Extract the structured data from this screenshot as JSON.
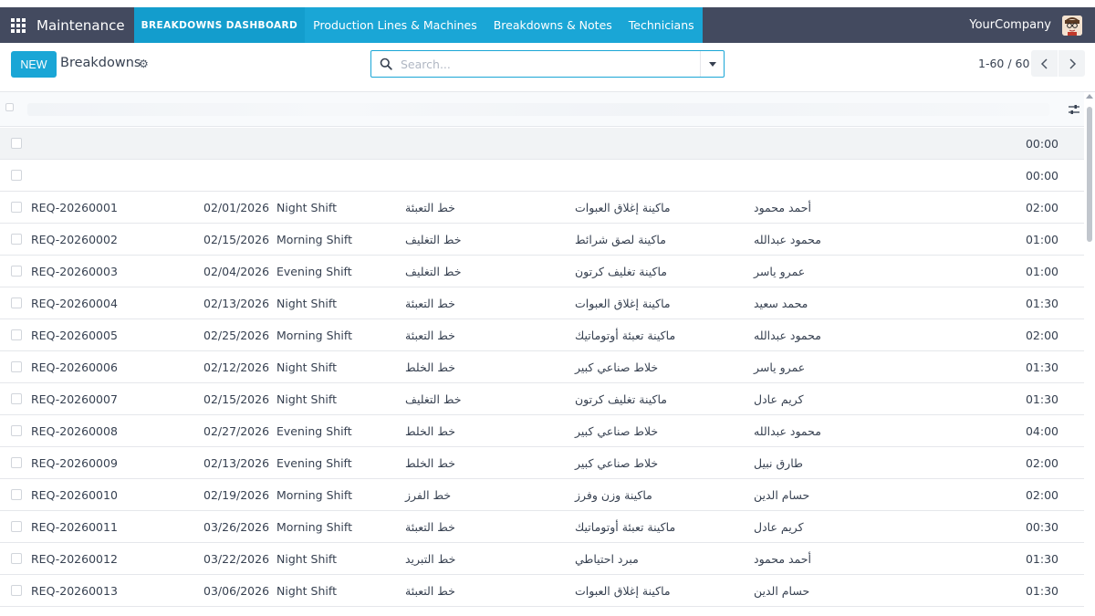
{
  "navbar": {
    "app_name": "Maintenance",
    "menu": [
      {
        "label": "BREAKDOWNS DASHBOARD",
        "active": true
      },
      {
        "label": "Production Lines & Machines",
        "active": false
      },
      {
        "label": "Breakdowns & Notes",
        "active": false
      },
      {
        "label": "Technicians",
        "active": false
      }
    ],
    "company": "YourCompany",
    "colors": {
      "navbar": "#434a5f",
      "accent": "#1aa6d6"
    }
  },
  "control_panel": {
    "new_label": "NEW",
    "title": "Breakdowns",
    "search_placeholder": "Search...",
    "pager_value": "1-60 / 60"
  },
  "icons": {
    "apps": "grid-icon",
    "gear": "gear-icon",
    "search": "search-icon",
    "dropdown": "caret-down-icon",
    "prev": "chevron-left-icon",
    "next": "chevron-right-icon",
    "optional_columns": "sliders-icon"
  },
  "table": {
    "group_rows": [
      {
        "duration": "00:00"
      },
      {
        "duration": "00:00"
      }
    ],
    "rows": [
      {
        "ref": "REQ-20260001",
        "date": "02/01/2026",
        "shift": "Night Shift",
        "line": "خط التعبئة",
        "machine": "ماكينة إغلاق العبوات",
        "technician": "أحمد محمود",
        "duration": "02:00"
      },
      {
        "ref": "REQ-20260002",
        "date": "02/15/2026",
        "shift": "Morning Shift",
        "line": "خط التغليف",
        "machine": "ماكينة لصق شرائط",
        "technician": "محمود عبدالله",
        "duration": "01:00"
      },
      {
        "ref": "REQ-20260003",
        "date": "02/04/2026",
        "shift": "Evening Shift",
        "line": "خط التغليف",
        "machine": "ماكينة تغليف كرتون",
        "technician": "عمرو ياسر",
        "duration": "01:00"
      },
      {
        "ref": "REQ-20260004",
        "date": "02/13/2026",
        "shift": "Night Shift",
        "line": "خط التعبئة",
        "machine": "ماكينة إغلاق العبوات",
        "technician": "محمد سعيد",
        "duration": "01:30"
      },
      {
        "ref": "REQ-20260005",
        "date": "02/25/2026",
        "shift": "Morning Shift",
        "line": "خط التعبئة",
        "machine": "ماكينة تعبئة أوتوماتيك",
        "technician": "محمود عبدالله",
        "duration": "02:00"
      },
      {
        "ref": "REQ-20260006",
        "date": "02/12/2026",
        "shift": "Night Shift",
        "line": "خط الخلط",
        "machine": "خلاط صناعي كبير",
        "technician": "عمرو ياسر",
        "duration": "01:30"
      },
      {
        "ref": "REQ-20260007",
        "date": "02/15/2026",
        "shift": "Night Shift",
        "line": "خط التغليف",
        "machine": "ماكينة تغليف كرتون",
        "technician": "كريم عادل",
        "duration": "01:30"
      },
      {
        "ref": "REQ-20260008",
        "date": "02/27/2026",
        "shift": "Evening Shift",
        "line": "خط الخلط",
        "machine": "خلاط صناعي كبير",
        "technician": "محمود عبدالله",
        "duration": "04:00"
      },
      {
        "ref": "REQ-20260009",
        "date": "02/13/2026",
        "shift": "Evening Shift",
        "line": "خط الخلط",
        "machine": "خلاط صناعي كبير",
        "technician": "طارق نبيل",
        "duration": "02:00"
      },
      {
        "ref": "REQ-20260010",
        "date": "02/19/2026",
        "shift": "Morning Shift",
        "line": "خط الفرز",
        "machine": "ماكينة وزن وفرز",
        "technician": "حسام الدين",
        "duration": "02:00"
      },
      {
        "ref": "REQ-20260011",
        "date": "03/26/2026",
        "shift": "Morning Shift",
        "line": "خط التعبئة",
        "machine": "ماكينة تعبئة أوتوماتيك",
        "technician": "كريم عادل",
        "duration": "00:30"
      },
      {
        "ref": "REQ-20260012",
        "date": "03/22/2026",
        "shift": "Night Shift",
        "line": "خط التبريد",
        "machine": "مبرد احتياطي",
        "technician": "أحمد محمود",
        "duration": "01:30"
      },
      {
        "ref": "REQ-20260013",
        "date": "03/06/2026",
        "shift": "Night Shift",
        "line": "خط التعبئة",
        "machine": "ماكينة إغلاق العبوات",
        "technician": "حسام الدين",
        "duration": "01:30"
      }
    ]
  }
}
